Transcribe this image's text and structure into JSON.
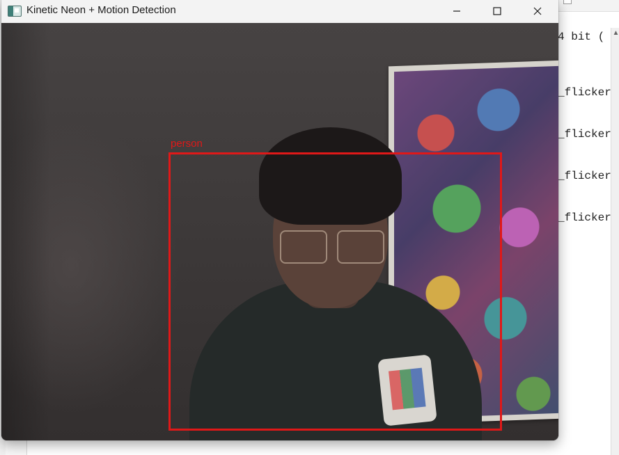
{
  "window": {
    "title": "Kinetic Neon + Motion Detection",
    "icon": "app-window-icon",
    "controls": {
      "minimize": "minimize-icon",
      "maximize": "maximize-icon",
      "close": "close-icon"
    }
  },
  "detection": {
    "label": "person",
    "box_color": "#e01818"
  },
  "background_window": {
    "lines": [
      "4 bit (",
      "_flicker",
      "_flicker",
      "_flicker",
      "_flicker"
    ]
  },
  "colors": {
    "titlebar": "#f3f3f3",
    "detection": "#e01818"
  }
}
